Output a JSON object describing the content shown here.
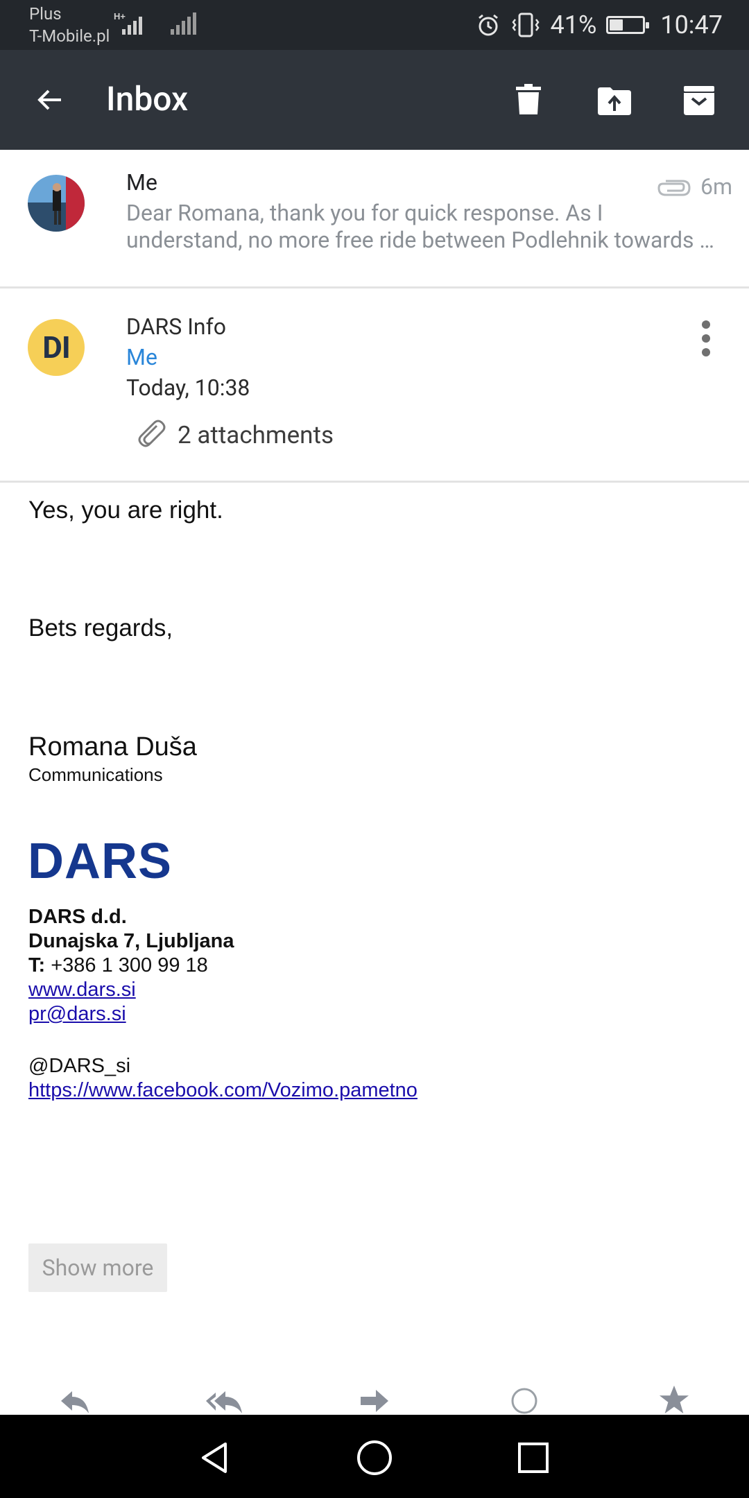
{
  "status_bar": {
    "carrier_top": "Plus",
    "carrier_bottom": "T-Mobile.pl",
    "network_badge": "H+",
    "battery": "41%",
    "battery_level": 0.41,
    "time": "10:47"
  },
  "app_bar": {
    "title": "Inbox",
    "icons": [
      "back-arrow-icon",
      "delete-icon",
      "move-to-icon",
      "archive-icon"
    ]
  },
  "thread_item": {
    "sender": "Me",
    "time": "6m",
    "snippet_line1": "Dear Romana, thank you for quick response. As I",
    "snippet_line2": "understand, no more free ride between Podlehnik towards …"
  },
  "message": {
    "avatar_initials": "DI",
    "sender": "DARS Info",
    "recipient": "Me",
    "date": "Today, 10:38",
    "attachments_label": "2 attachments"
  },
  "body": {
    "line1": "Yes, you are right.",
    "line2": "Bets regards,",
    "signature_name": "Romana Duša",
    "signature_role": "Communications",
    "logo_text": "DARS",
    "company": "DARS d.d.",
    "address": "Dunajska 7, Ljubljana",
    "phone_label": "T:",
    "phone": "+386 1 300 99 18",
    "website": "www.dars.si",
    "email": "pr@dars.si",
    "twitter": "@DARS_si",
    "facebook": "https://www.facebook.com/Vozimo.pametno"
  },
  "show_more_label": "Show more",
  "actions": [
    "reply-icon",
    "reply-all-icon",
    "forward-icon",
    "circle-icon",
    "star-icon"
  ],
  "colors": {
    "status_bar": "#23272c",
    "app_bar": "#2f343b",
    "recipient_link": "#2a86d9",
    "logo": "#15378e",
    "avatar_di": "#f6cf57",
    "hyperlink": "#1a0dab"
  }
}
